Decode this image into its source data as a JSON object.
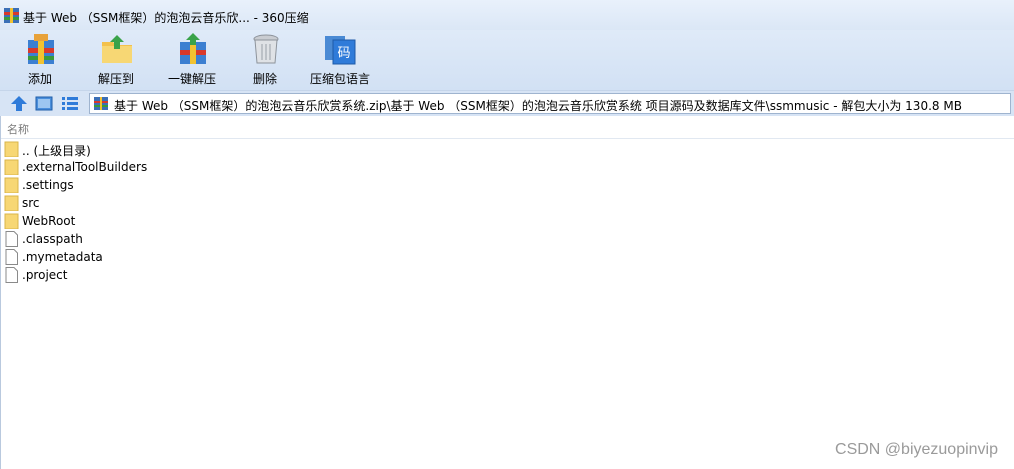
{
  "window": {
    "title": "基于 Web （SSM框架）的泡泡云音乐欣... - 360压缩"
  },
  "toolbar": {
    "items": [
      {
        "label": "添加",
        "icon": "add-archive-icon"
      },
      {
        "label": "解压到",
        "icon": "extract-to-icon"
      },
      {
        "label": "一键解压",
        "icon": "one-click-extract-icon"
      },
      {
        "label": "删除",
        "icon": "delete-icon"
      },
      {
        "label": "压缩包语言",
        "icon": "archive-language-icon"
      }
    ]
  },
  "nav": {
    "buttons": [
      "up-icon",
      "view-icon",
      "list-view-icon"
    ],
    "address": "基于 Web （SSM框架）的泡泡云音乐欣赏系统.zip\\基于 Web （SSM框架）的泡泡云音乐欣赏系统 项目源码及数据库文件\\ssmmusic - 解包大小为 130.8 MB"
  },
  "list": {
    "column_name": "名称",
    "items": [
      {
        "name": ".. (上级目录)",
        "type": "folder"
      },
      {
        "name": ".externalToolBuilders",
        "type": "folder"
      },
      {
        "name": ".settings",
        "type": "folder"
      },
      {
        "name": "src",
        "type": "folder"
      },
      {
        "name": "WebRoot",
        "type": "folder"
      },
      {
        "name": ".classpath",
        "type": "file"
      },
      {
        "name": ".mymetadata",
        "type": "file"
      },
      {
        "name": ".project",
        "type": "file"
      }
    ]
  },
  "watermark": "CSDN @biyezuopinvip",
  "colors": {
    "titlebar": "#dbe7f6",
    "toolbar": "#d2e1f4",
    "folder": "#f7d774",
    "accent": "#2f7bd9"
  }
}
